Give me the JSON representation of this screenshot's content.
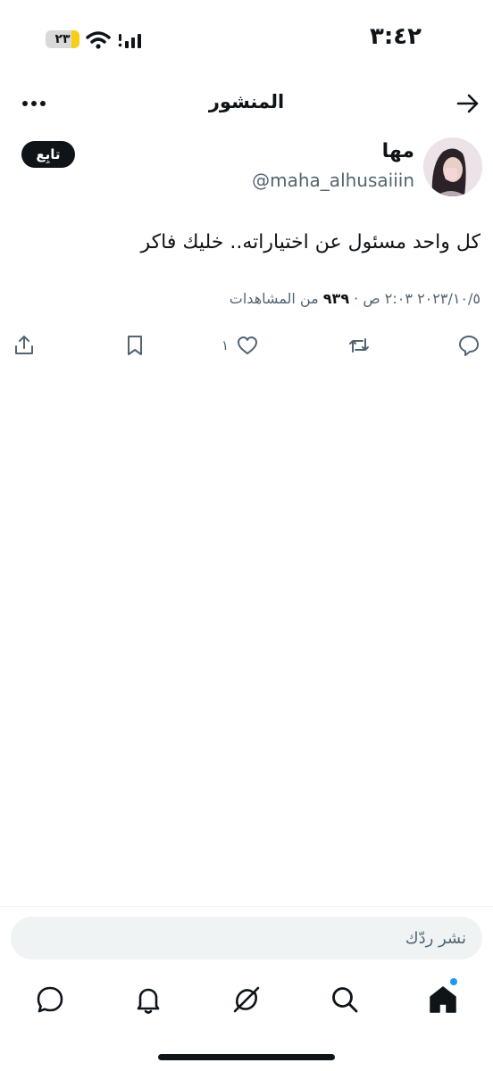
{
  "status_bar": {
    "time": "٣:٤٢",
    "battery_label": "٢٣",
    "battery_level": 0.23
  },
  "header": {
    "title": "المنشور",
    "back_icon": "arrow-right-icon",
    "more_icon": "more-horizontal-icon"
  },
  "author": {
    "name": "مها",
    "handle": "@maha_alhusaiiin",
    "follow_label": "تابِع"
  },
  "post": {
    "text": "كل واحد مسئول عن اختياراته.. خليك فاكر",
    "date": "٢٠٢٣/١٠/٥",
    "time": "٢:٠٣ ص",
    "separator": "·",
    "views_count": "٩٣٩",
    "views_label": "من المشاهدات"
  },
  "actions": {
    "reply_icon": "reply-icon",
    "repost_icon": "repost-icon",
    "like_icon": "heart-icon",
    "like_count": "١",
    "bookmark_icon": "bookmark-icon",
    "share_icon": "share-icon"
  },
  "composer": {
    "placeholder": "نشر ردّك"
  },
  "tab_bar": {
    "items": [
      "home-icon",
      "search-icon",
      "grok-icon",
      "bell-icon",
      "messages-icon"
    ],
    "active": "home-icon"
  },
  "colors": {
    "text": "#0f1419",
    "secondary_text": "#536471",
    "accent": "#1d9bf0",
    "battery": "#f6cf14",
    "composer_bg": "#eff3f4"
  }
}
